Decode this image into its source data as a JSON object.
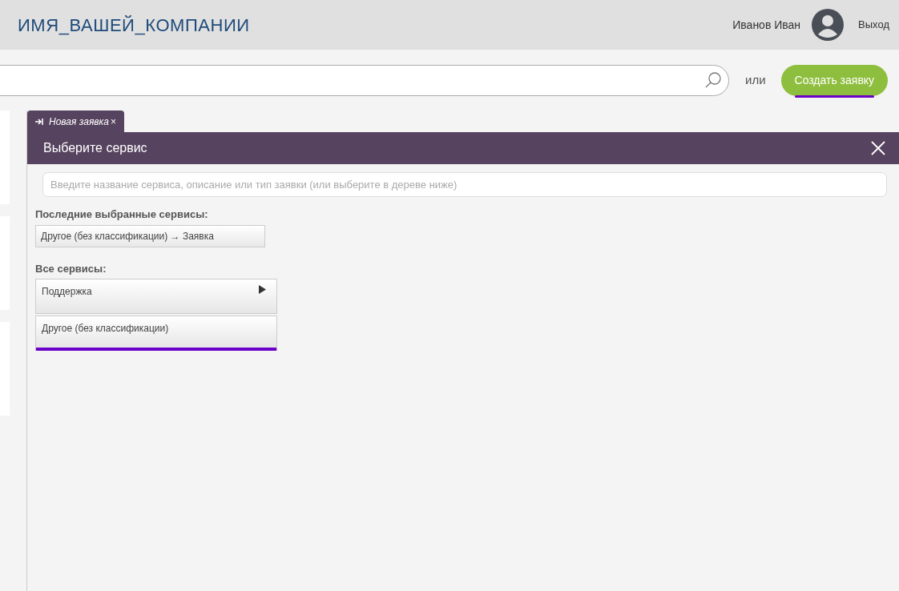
{
  "header": {
    "company": "ИМЯ_ВАШЕЙ_КОМПАНИИ",
    "user_name": "Иванов Иван",
    "logout": "Выход"
  },
  "search": {
    "or_label": "или",
    "create_button": "Создать заявку"
  },
  "tab": {
    "label": "Новая заявка",
    "close": "×",
    "selected": true
  },
  "dialog": {
    "title": "Выберите сервис",
    "search_placeholder": "Введите название сервиса, описание или тип заявки (или выберите в дереве ниже)",
    "recent_heading": "Последние выбранные сервисы:",
    "recent": [
      "Другое (без классификации) → Заявка"
    ],
    "all_heading": "Все сервисы:",
    "services": [
      {
        "label": "Поддержка",
        "kind": "branch",
        "selected": false
      },
      {
        "label": "Другое (без классификации)",
        "kind": "leaf",
        "selected": true
      }
    ]
  }
}
